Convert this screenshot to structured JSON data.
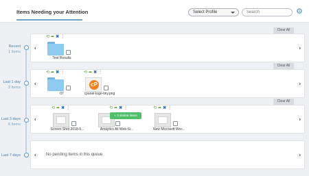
{
  "header": {
    "title": "Items Needing your Attention",
    "profile_select": "Select Profile",
    "search_placeholder": "Search"
  },
  "clear_all_label": "Clear All",
  "timeline": [
    {
      "label": "Recent",
      "count": "1 Items"
    },
    {
      "label": "Last 1 day",
      "count": "2 Items"
    },
    {
      "label": "Last 3 days",
      "count": "6 Items"
    },
    {
      "label": "Last 7 days",
      "count": ""
    }
  ],
  "queues": {
    "recent": [
      {
        "name": "Test Results",
        "kind": "folder-icon"
      }
    ],
    "last1": [
      {
        "name": "07",
        "kind": "folder-icon"
      },
      {
        "name": "cpanel-logo-tiny.png",
        "kind": "cpanel-logo-icon",
        "logo_text": "cP"
      }
    ],
    "last3": [
      {
        "name": "Screen Shot 2018-0...",
        "kind": "screenshot-thumbnail"
      },
      {
        "name": "Analytics All Web Si...",
        "kind": "document-thumbnail",
        "badge": "+ 3 similar items"
      },
      {
        "name": "New Microsoft Wor...",
        "kind": "document-thumbnail"
      }
    ],
    "last7_empty": "No pending items in this queue"
  },
  "icons": {
    "restore": "⟲",
    "forward": "➦",
    "delete": "✖",
    "more": "⋮",
    "gear": "⚙",
    "prev": "‹",
    "next": "›"
  },
  "colors": {
    "accent": "#4a90c8",
    "action_green": "#5a9c2e",
    "action_blue": "#2f6fb5",
    "badge_green": "#4fc06a",
    "folder_blue": "#8ccaf2",
    "cpanel_orange": "#f0801e"
  }
}
